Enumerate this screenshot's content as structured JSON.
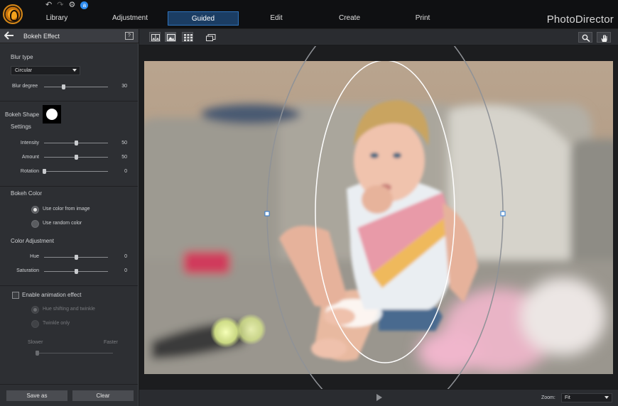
{
  "app": {
    "brand": "PhotoDirector"
  },
  "main_tabs": [
    {
      "label": "Library"
    },
    {
      "label": "Adjustment"
    },
    {
      "label": "Guided",
      "active": true
    },
    {
      "label": "Edit"
    },
    {
      "label": "Create"
    },
    {
      "label": "Print"
    }
  ],
  "quick_icons": {
    "undo": "↶",
    "redo": "↷",
    "settings": "⚙",
    "notify": "a"
  },
  "panel": {
    "title": "Bokeh Effect",
    "help": "?",
    "blur_type": {
      "label": "Blur type",
      "selected": "Circular"
    },
    "blur_degree": {
      "label": "Blur degree",
      "value": "30",
      "level": 0.3
    },
    "bokeh_shape": {
      "label": "Bokeh Shape"
    },
    "settings": {
      "label": "Settings",
      "intensity": {
        "label": "Intensity",
        "value": "50",
        "level": 0.5
      },
      "amount": {
        "label": "Amount",
        "value": "50",
        "level": 0.5
      },
      "rotation": {
        "label": "Rotation",
        "value": "0",
        "level": 0.0
      }
    },
    "bokeh_color": {
      "label": "Bokeh Color",
      "opt_image": "Use color from image",
      "opt_random": "Use random color",
      "selected": "image"
    },
    "color_adjustment": {
      "label": "Color Adjustment",
      "hue": {
        "label": "Hue",
        "value": "0",
        "level": 0.5
      },
      "saturation": {
        "label": "Saturation",
        "value": "0",
        "level": 0.5
      }
    },
    "animation": {
      "label": "Enable animation effect",
      "enabled": false,
      "opt_hue": "Hue shifting and twinkle",
      "opt_twinkle": "Twinkle only",
      "slower": "Slower",
      "faster": "Faster",
      "speed_level": 0.0
    },
    "save_as": "Save as",
    "clear": "Clear"
  },
  "viewer": {
    "zoom_label": "Zoom:",
    "zoom_value": "Fit"
  },
  "colors": {
    "accent": "#2f74bd",
    "panel_bg": "#2d2f33",
    "topbar_bg": "#0f1012"
  }
}
